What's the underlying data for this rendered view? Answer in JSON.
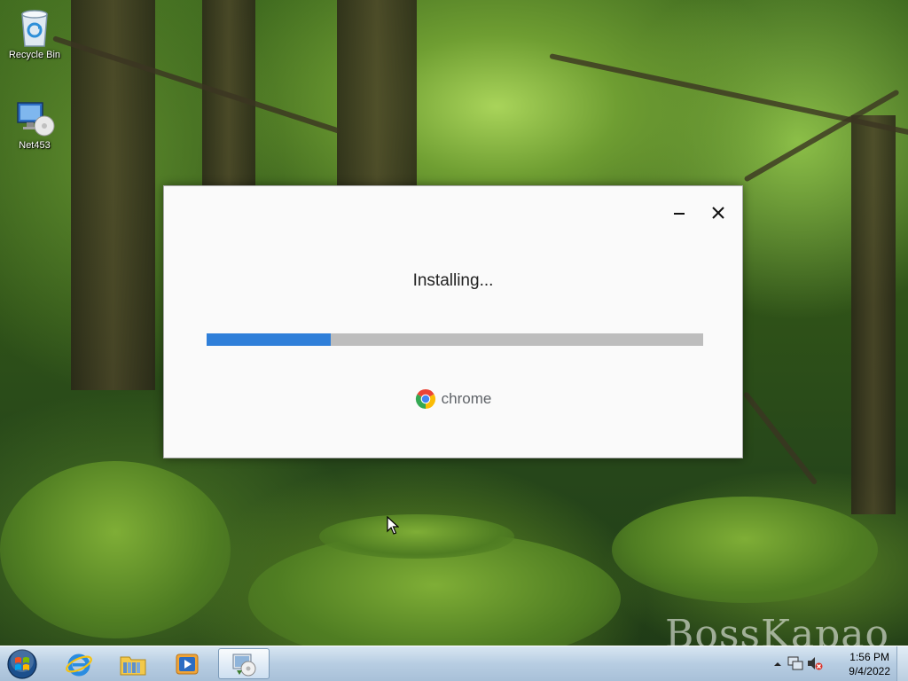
{
  "desktop": {
    "icons": [
      {
        "label": "Recycle Bin",
        "icon": "recycle-bin-icon"
      },
      {
        "label": "Net453",
        "icon": "network-setup-icon"
      }
    ],
    "watermark": "BossKapao"
  },
  "installer": {
    "status": "Installing...",
    "progress_fraction": 0.25,
    "brand_name": "chrome",
    "minimize_icon": "minimize-icon",
    "close_icon": "close-icon",
    "colors": {
      "progress_fill": "#2f7fd9",
      "progress_track": "#bdbdbd"
    }
  },
  "taskbar": {
    "start_icon": "windows-orb-icon",
    "pinned": [
      {
        "icon": "internet-explorer-icon"
      },
      {
        "icon": "file-explorer-icon"
      },
      {
        "icon": "media-player-icon"
      },
      {
        "icon": "installer-app-icon",
        "active": true
      }
    ],
    "tray": {
      "icons": [
        "show-hidden-icons-chevron",
        "network-icon",
        "volume-muted-icon"
      ],
      "time": "1:56 PM",
      "date": "9/4/2022"
    }
  }
}
